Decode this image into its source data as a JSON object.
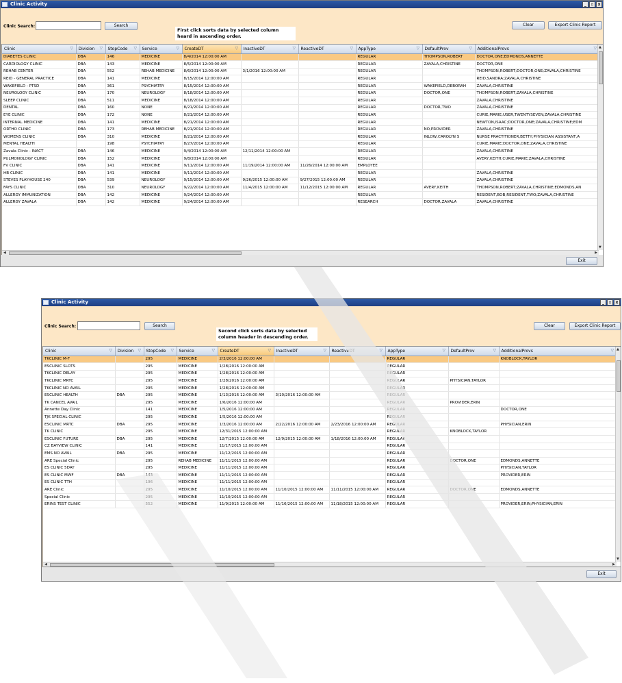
{
  "window1": {
    "title": "Clinic Activity",
    "search_label": "Clinic Search:",
    "search_value": "",
    "search_button": "Search",
    "clear_button": "Clear",
    "export_button": "Export Clinic Report",
    "exit_button": "Exit",
    "note": "First click sorts data by selected column heard in ascending order.",
    "columns": [
      "Clinic",
      "Division",
      "StopCode",
      "Service",
      "CreateDT",
      "InactiveDT",
      "ReactiveDT",
      "AppType",
      "DefaultProv",
      "AdditionalProvs"
    ],
    "sorted_column": "CreateDT",
    "rows": [
      [
        "DIABETES CLINIC",
        "DBA",
        "146",
        "MEDICINE",
        "8/4/2014 12:00:00 AM",
        "",
        "",
        "REGULAR",
        "THOMPSON,ROBERT",
        "DOCTOR,ONE;EDMONDS,ANNETTE"
      ],
      [
        "CARDIOLOGY CLINIC",
        "DBA",
        "143",
        "MEDICINE",
        "8/5/2014 12:00:00 AM",
        "",
        "",
        "REGULAR",
        "ZAVALA,CHRISTINE",
        "DOCTOR,ONE"
      ],
      [
        "REHAB CENTER",
        "DBA",
        "552",
        "REHAB MEDICINE",
        "8/6/2014 12:00:00 AM",
        "3/1/2016 12:00:00 AM",
        "",
        "REGULAR",
        "",
        "THOMPSON,ROBERT;DOCTOR,ONE;ZAVALA,CHRISTINE"
      ],
      [
        "REID - GENERAL PRACTICE",
        "DBA",
        "141",
        "MEDICINE",
        "8/15/2014 12:00:00 AM",
        "",
        "",
        "REGULAR",
        "",
        "REID,SANDRA;ZAVALA,CHRISTINE"
      ],
      [
        "WAKEFIELD - PTSD",
        "DBA",
        "361",
        "PSYCHIATRY",
        "8/15/2014 12:00:00 AM",
        "",
        "",
        "REGULAR",
        "WAKEFIELD,DEBORAH",
        "ZAVALA,CHRISTINE"
      ],
      [
        "NEUROLOGY CLINIC",
        "DBA",
        "170",
        "NEUROLOGY",
        "8/18/2014 12:00:00 AM",
        "",
        "",
        "REGULAR",
        "DOCTOR,ONE",
        "THOMPSON,ROBERT;ZAVALA,CHRISTINE"
      ],
      [
        "SLEEP CLINIC",
        "DBA",
        "511",
        "MEDICINE",
        "8/18/2014 12:00:00 AM",
        "",
        "",
        "REGULAR",
        "",
        "ZAVALA,CHRISTINE"
      ],
      [
        "DENTAL",
        "DBA",
        "160",
        "NONE",
        "8/21/2014 12:00:00 AM",
        "",
        "",
        "REGULAR",
        "DOCTOR,TWO",
        "ZAVALA,CHRISTINE"
      ],
      [
        "EYE CLINIC",
        "DBA",
        "172",
        "NONE",
        "8/21/2014 12:00:00 AM",
        "",
        "",
        "REGULAR",
        "",
        "CURIE,MARIE;USER,TWENTYSEVEN;ZAVALA,CHRISTINE"
      ],
      [
        "INTERNAL MEDICINE",
        "DBA",
        "141",
        "MEDICINE",
        "8/21/2014 12:00:00 AM",
        "",
        "",
        "REGULAR",
        "",
        "NEWTON,ISAAC;DOCTOR,ONE;ZAVALA,CHRISTINE;EDM"
      ],
      [
        "ORTHO CLINIC",
        "DBA",
        "173",
        "REHAB MEDICINE",
        "8/21/2014 12:00:00 AM",
        "",
        "",
        "REGULAR",
        "NO,PROVIDER",
        "ZAVALA,CHRISTINE"
      ],
      [
        "WOMENS CLINIC",
        "DBA",
        "310",
        "MEDICINE",
        "8/21/2014 12:00:00 AM",
        "",
        "",
        "REGULAR",
        "INLOW,CAROLYN S",
        "NURSE PRACTITIONER,BETTY;PHYSICIAN ASSISTANT,A"
      ],
      [
        "MENTAL HEALTH",
        "",
        "198",
        "PSYCHIATRY",
        "8/27/2014 12:00:00 AM",
        "",
        "",
        "REGULAR",
        "",
        "CURIE,MARIE;DOCTOR,ONE;ZAVALA,CHRISTINE"
      ],
      [
        "Zavala Clinic - INACT",
        "DBA",
        "146",
        "MEDICINE",
        "9/4/2014 12:00:00 AM",
        "12/11/2014 12:00:00 AM",
        "",
        "REGULAR",
        "",
        "ZAVALA,CHRISTINE"
      ],
      [
        "PULMONOLOGY CLINIC",
        "DBA",
        "152",
        "MEDICINE",
        "9/8/2014 12:00:00 AM",
        "",
        "",
        "REGULAR",
        "",
        "AVERY,KEITH;CURIE,MARIE;ZAVALA,CHRISTINE"
      ],
      [
        "FV CLINIC",
        "DBA",
        "141",
        "MEDICINE",
        "9/11/2014 12:00:00 AM",
        "11/19/2014 12:00:00 AM",
        "11/26/2014 12:00:00 AM",
        "EMPLOYEE",
        "",
        ""
      ],
      [
        "HB CLINIC",
        "DBA",
        "141",
        "MEDICINE",
        "9/11/2014 12:00:00 AM",
        "",
        "",
        "REGULAR",
        "",
        "ZAVALA,CHRISTINE"
      ],
      [
        "STEVES PLAYHOUSE 240",
        "DBA",
        "539",
        "NEUROLOGY",
        "9/15/2014 12:00:00 AM",
        "9/26/2015 12:00:00 AM",
        "9/27/2015 12:00:00 AM",
        "REGULAR",
        "",
        "ZAVALA,CHRISTINE"
      ],
      [
        "FAYS CLINIC",
        "DBA",
        "310",
        "NEUROLOGY",
        "9/22/2014 12:00:00 AM",
        "11/4/2015 12:00:00 AM",
        "11/12/2015 12:00:00 AM",
        "REGULAR",
        "AVERY,KEITH",
        "THOMPSON,ROBERT;ZAVALA,CHRISTINE;EDMONDS,AN"
      ],
      [
        "ALLERGY IMMUNIZATION",
        "DBA",
        "142",
        "MEDICINE",
        "9/24/2014 12:00:00 AM",
        "",
        "",
        "REGULAR",
        "",
        "RESIDENT,BOB;RESIDENT,TWO;ZAVALA,CHRISTINE"
      ],
      [
        "ALLERGY ZAVALA",
        "DBA",
        "142",
        "MEDICINE",
        "9/24/2014 12:00:00 AM",
        "",
        "",
        "RESEARCH",
        "DOCTOR,ZAVALA",
        "ZAVALA,CHRISTINE"
      ]
    ]
  },
  "window2": {
    "title": "Clinic Activity",
    "search_label": "Clinic Search:",
    "search_value": "",
    "search_button": "Search",
    "clear_button": "Clear",
    "export_button": "Export Clinic Report",
    "exit_button": "Exit",
    "note": "Second click sorts data by selected column header in descending order.",
    "columns": [
      "Clinic",
      "Division",
      "StopCode",
      "Service",
      "CreateDT",
      "InactiveDT",
      "ReactiveDT",
      "AppType",
      "DefaultProv",
      "AdditionalProvs"
    ],
    "sorted_column": "CreateDT",
    "rows": [
      [
        "TKCLINIC M-F",
        "",
        "295",
        "MEDICINE",
        "2/3/2016 12:00:00 AM",
        "",
        "",
        "REGULAR",
        "",
        "KNOBLOCK,TAYLOR"
      ],
      [
        "ESCLINIC SLOTS",
        "",
        "295",
        "MEDICINE",
        "1/28/2016 12:00:00 AM",
        "",
        "",
        "REGULAR",
        "",
        ""
      ],
      [
        "TKCLINIC DELAY",
        "",
        "295",
        "MEDICINE",
        "1/28/2016 12:00:00 AM",
        "",
        "",
        "REGULAR",
        "",
        ""
      ],
      [
        "TKCLINIC MRTC",
        "",
        "295",
        "MEDICINE",
        "1/28/2016 12:00:00 AM",
        "",
        "",
        "REGULAR",
        "PHYSICIAN,TAYLOR",
        ""
      ],
      [
        "TKCLINIC NO AVAIL",
        "",
        "295",
        "MEDICINE",
        "1/28/2016 12:00:00 AM",
        "",
        "",
        "REGULAR",
        "",
        ""
      ],
      [
        "ESCLINIC HEALTH",
        "DBA",
        "295",
        "MEDICINE",
        "1/13/2016 12:00:00 AM",
        "3/10/2016 12:00:00 AM",
        "",
        "REGULAR",
        "",
        ""
      ],
      [
        "TK CANCEL AVAIL",
        "",
        "295",
        "MEDICINE",
        "1/6/2016 12:00:00 AM",
        "",
        "",
        "REGULAR",
        "PROVIDER,ERIN",
        ""
      ],
      [
        "Annette Day Clinic",
        "",
        "141",
        "MEDICINE",
        "1/5/2016 12:00:00 AM",
        "",
        "",
        "REGULAR",
        "",
        "DOCTOR,ONE"
      ],
      [
        "TJK SPECIAL CLINIC",
        "",
        "295",
        "MEDICINE",
        "1/5/2016 12:00:00 AM",
        "",
        "",
        "REGULAR",
        "",
        ""
      ],
      [
        "ESCLINIC MRTC",
        "DBA",
        "295",
        "MEDICINE",
        "1/3/2016 12:00:00 AM",
        "2/22/2016 12:00:00 AM",
        "2/23/2016 12:00:00 AM",
        "REGULAR",
        "",
        "PHYSICIAN,ERIN"
      ],
      [
        "TK CLINIC",
        "",
        "295",
        "MEDICINE",
        "12/31/2015 12:00:00 AM",
        "",
        "",
        "REGULAR",
        "KNOBLOCK,TAYLOR",
        ""
      ],
      [
        "ESCLINIC FUTURE",
        "DBA",
        "295",
        "MEDICINE",
        "12/7/2015 12:00:00 AM",
        "12/9/2015 12:00:00 AM",
        "1/18/2016 12:00:00 AM",
        "REGULAR",
        "",
        ""
      ],
      [
        "CZ BAYVIEW CLINIC",
        "",
        "141",
        "MEDICINE",
        "11/17/2015 12:00:00 AM",
        "",
        "",
        "REGULAR",
        "",
        ""
      ],
      [
        "EMS NO AVAIL",
        "DBA",
        "295",
        "MEDICINE",
        "11/12/2015 12:00:00 AM",
        "",
        "",
        "REGULAR",
        "",
        ""
      ],
      [
        "ARE Special Clinic",
        "",
        "295",
        "REHAB MEDICINE",
        "11/11/2015 12:00:00 AM",
        "",
        "",
        "REGULAR",
        "DOCTOR,ONE",
        "EDMONDS,ANNETTE"
      ],
      [
        "ES CLINIC 5DAY",
        "",
        "295",
        "MEDICINE",
        "11/11/2015 12:00:00 AM",
        "",
        "",
        "REGULAR",
        "",
        "PHYSICIAN,TAYLOR"
      ],
      [
        "ES CLINIC MWF",
        "DBA",
        "143",
        "MEDICINE",
        "11/11/2015 12:00:00 AM",
        "",
        "",
        "REGULAR",
        "",
        "PROVIDER,ERIN"
      ],
      [
        "ES CLINIC TTH",
        "",
        "196",
        "MEDICINE",
        "11/11/2015 12:00:00 AM",
        "",
        "",
        "REGULAR",
        "",
        ""
      ],
      [
        "ARE Clinic",
        "",
        "295",
        "MEDICINE",
        "11/10/2015 12:00:00 AM",
        "11/10/2015 12:00:00 AM",
        "11/11/2015 12:00:00 AM",
        "REGULAR",
        "DOCTOR,ONE",
        "EDMONDS,ANNETTE"
      ],
      [
        "Special Clinic",
        "",
        "295",
        "MEDICINE",
        "11/10/2015 12:00:00 AM",
        "",
        "",
        "REGULAR",
        "",
        ""
      ],
      [
        "ERINS TEST CLINIC",
        "",
        "552",
        "MEDICINE",
        "11/9/2015 12:00:00 AM",
        "11/16/2015 12:00:00 AM",
        "11/18/2015 12:00:00 AM",
        "REGULAR",
        "",
        "PROVIDER,ERIN;PHYSICIAN,ERIN"
      ]
    ]
  }
}
